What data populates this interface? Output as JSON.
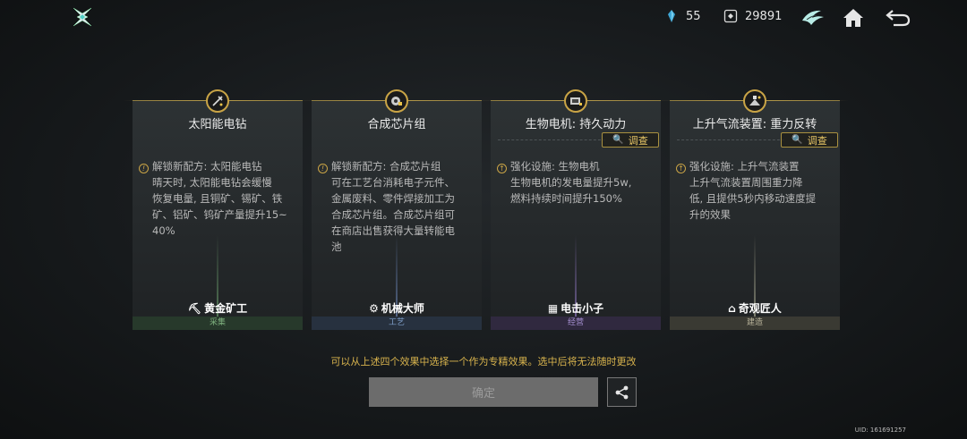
{
  "topbar": {
    "crystal_icon": "crystal-icon",
    "crystal_count": "55",
    "coin_icon": "coin-icon",
    "coin_count": "29891"
  },
  "cards": [
    {
      "title": "太阳能电钻",
      "icon": "drill-icon",
      "has_probe": false,
      "desc_lines": [
        "解锁新配方: 太阳能电钻",
        "晴天时, 太阳能电钻会缓慢",
        "恢复电量, 且铜矿、锡矿、铁",
        "矿、铝矿、钨矿产量提升15~",
        "40%"
      ],
      "role": "黄金矿工",
      "role_icon": "pickaxe-icon",
      "footer": "采集",
      "footer_bg": "#27392b",
      "footer_color": "#7fb27f",
      "beam_color": "#7fbf7f"
    },
    {
      "title": "合成芯片组",
      "icon": "chip-icon",
      "has_probe": false,
      "desc_lines": [
        "解锁新配方: 合成芯片组",
        "可在工艺台消耗电子元件、",
        "金属废料、零件焊接加工为",
        "合成芯片组。合成芯片组可",
        "在商店出售获得大量转能电",
        "池"
      ],
      "role": "机械大师",
      "role_icon": "gear-icon",
      "footer": "工艺",
      "footer_bg": "#27313f",
      "footer_color": "#7f9fc9",
      "beam_color": "#7f9fdf"
    },
    {
      "title": "生物电机: 持久动力",
      "icon": "motor-icon",
      "has_probe": true,
      "probe_label": "调查",
      "desc_lines": [
        "强化设施: 生物电机",
        "生物电机的发电量提升5w,",
        "燃料持续时间提升150%"
      ],
      "role": "电击小子",
      "role_icon": "battery-icon",
      "footer": "经营",
      "footer_bg": "#30293f",
      "footer_color": "#a58fd0",
      "beam_color": "#b08fef"
    },
    {
      "title": "上升气流装置: 重力反转",
      "icon": "updraft-icon",
      "has_probe": true,
      "probe_label": "调查",
      "desc_lines": [
        "强化设施: 上升气流装置",
        "上升气流装置周围重力降",
        "低, 且提供5秒内移动速度提",
        "升的效果"
      ],
      "role": "奇观匠人",
      "role_icon": "structure-icon",
      "footer": "建造",
      "footer_bg": "#3a3a33",
      "footer_color": "#b8b39a",
      "beam_color": "#d0d0b0"
    }
  ],
  "hint": "可以从上述四个效果中选择一个作为专精效果。选中后将无法随时更改",
  "confirm_label": "确定",
  "uid": "UID: 161691257"
}
